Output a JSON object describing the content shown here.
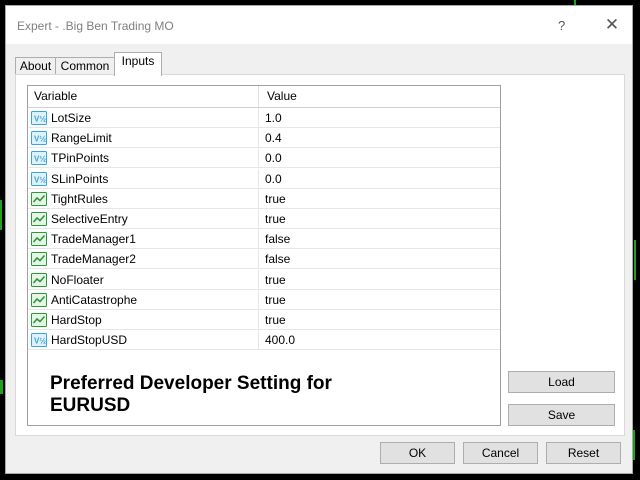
{
  "window": {
    "title": "Expert - .Big Ben Trading MO",
    "help_glyph": "?",
    "close_glyph": "✕"
  },
  "tabs": [
    {
      "label": "About",
      "active": false
    },
    {
      "label": "Common",
      "active": false
    },
    {
      "label": "Inputs",
      "active": true
    }
  ],
  "grid": {
    "col_variable": "Variable",
    "col_value": "Value",
    "rows": [
      {
        "name": "LotSize",
        "value": "1.0",
        "icon": "numeric-variable-icon"
      },
      {
        "name": "RangeLimit",
        "value": "0.4",
        "icon": "numeric-variable-icon"
      },
      {
        "name": "TPinPoints",
        "value": "0.0",
        "icon": "numeric-variable-icon"
      },
      {
        "name": "SLinPoints",
        "value": "0.0",
        "icon": "numeric-variable-icon"
      },
      {
        "name": "TightRules",
        "value": "true",
        "icon": "boolean-variable-icon"
      },
      {
        "name": "SelectiveEntry",
        "value": "true",
        "icon": "boolean-variable-icon"
      },
      {
        "name": "TradeManager1",
        "value": "false",
        "icon": "boolean-variable-icon"
      },
      {
        "name": "TradeManager2",
        "value": "false",
        "icon": "boolean-variable-icon"
      },
      {
        "name": "NoFloater",
        "value": "true",
        "icon": "boolean-variable-icon"
      },
      {
        "name": "AntiCatastrophe",
        "value": "true",
        "icon": "boolean-variable-icon"
      },
      {
        "name": "HardStop",
        "value": "true",
        "icon": "boolean-variable-icon"
      },
      {
        "name": "HardStopUSD",
        "value": "400.0",
        "icon": "numeric-variable-icon"
      }
    ]
  },
  "note": {
    "line1": "Preferred Developer Setting for",
    "line2": "EURUSD"
  },
  "buttons": {
    "load": "Load",
    "save": "Save",
    "ok": "OK",
    "cancel": "Cancel",
    "reset": "Reset"
  },
  "colors": {
    "numeric_icon": "#3aa6d8",
    "boolean_icon": "#2a9a3a",
    "chart_tick": "#1ea21e"
  }
}
